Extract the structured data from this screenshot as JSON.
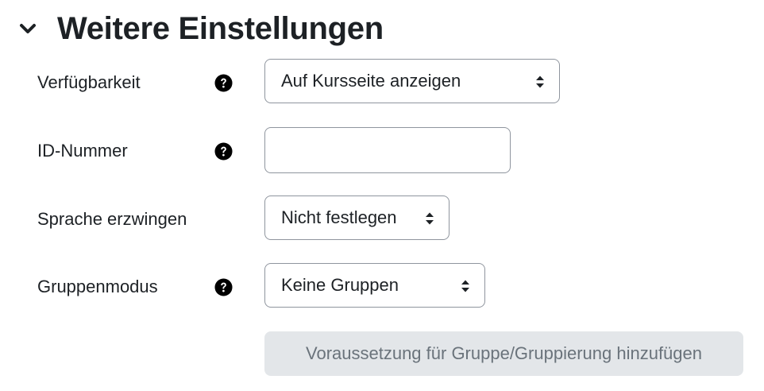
{
  "section": {
    "title": "Weitere Einstellungen",
    "toggle_icon": "chevron-down-icon",
    "expanded": true
  },
  "fields": {
    "availability": {
      "label": "Verfügbarkeit",
      "help_icon": "question-circle-icon",
      "value": "Auf Kursseite anzeigen"
    },
    "id_number": {
      "label": "ID-Nummer",
      "help_icon": "question-circle-icon",
      "value": "",
      "placeholder": ""
    },
    "force_language": {
      "label": "Sprache erzwingen",
      "value": "Nicht festlegen"
    },
    "group_mode": {
      "label": "Gruppenmodus",
      "help_icon": "question-circle-icon",
      "value": "Keine Gruppen"
    }
  },
  "restriction_button": {
    "label": "Voraussetzung für Gruppe/Gruppierung hinzufügen",
    "disabled": true
  },
  "colors": {
    "text": "#1d2125",
    "border": "#8f959e",
    "disabled_bg": "#e3e6e9",
    "disabled_text": "#6a737b"
  }
}
